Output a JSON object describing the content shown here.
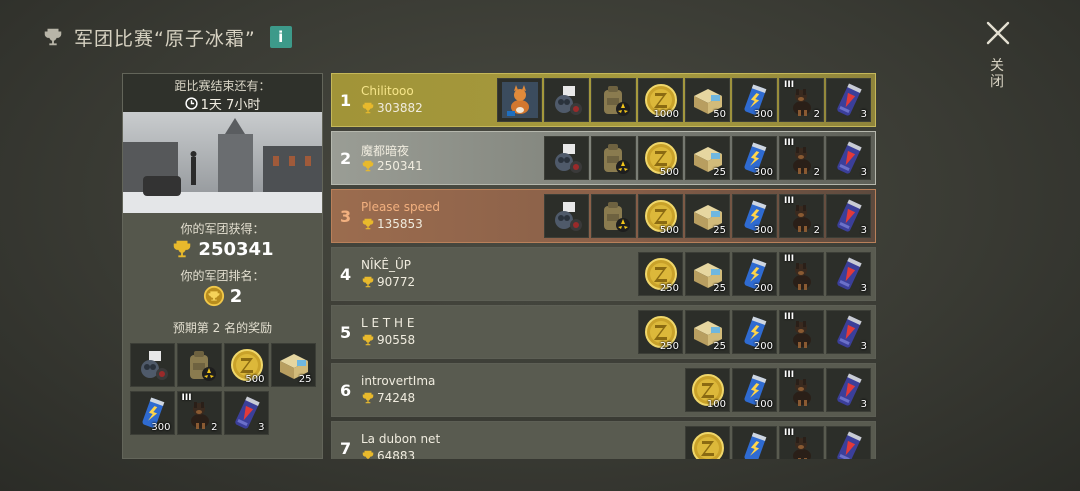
{
  "header": {
    "title": "军团比赛“原子冰霜”",
    "info_label": "i",
    "close_label": "关闭"
  },
  "left_panel": {
    "ends_label": "距比赛结束还有：",
    "time_left": "1天 7小时",
    "your_gain_label": "你的军团获得：",
    "your_points": "250341",
    "your_rank_label": "你的军团排名：",
    "your_rank": "2",
    "expected_label": "预期第 2 名的奖励",
    "rewards": [
      {
        "icon": "gasmask-icon",
        "qty": ""
      },
      {
        "icon": "backpack-icon",
        "qty": ""
      },
      {
        "icon": "coin-icon",
        "qty": "500"
      },
      {
        "icon": "supply-crate-icon",
        "qty": "25"
      },
      {
        "icon": "energy-can-icon",
        "qty": "300"
      },
      {
        "icon": "dog-icon",
        "qty": "2",
        "tier": "III"
      },
      {
        "icon": "soda-can-icon",
        "qty": "3"
      }
    ]
  },
  "ranking": [
    {
      "rank": "1",
      "name": "Chilitooo",
      "points": "303882",
      "items": [
        {
          "icon": "cat-pet-icon",
          "qty": ""
        },
        {
          "icon": "gasmask-icon",
          "qty": ""
        },
        {
          "icon": "backpack-icon",
          "qty": ""
        },
        {
          "icon": "coin-icon",
          "qty": "1000"
        },
        {
          "icon": "supply-crate-icon",
          "qty": "50"
        },
        {
          "icon": "energy-can-icon",
          "qty": "300"
        },
        {
          "icon": "dog-icon",
          "qty": "2",
          "tier": "III"
        },
        {
          "icon": "soda-can-icon",
          "qty": "3"
        }
      ]
    },
    {
      "rank": "2",
      "name": "魔都暗夜",
      "points": "250341",
      "items": [
        {
          "icon": "gasmask-icon",
          "qty": ""
        },
        {
          "icon": "backpack-icon",
          "qty": ""
        },
        {
          "icon": "coin-icon",
          "qty": "500"
        },
        {
          "icon": "supply-crate-icon",
          "qty": "25"
        },
        {
          "icon": "energy-can-icon",
          "qty": "300"
        },
        {
          "icon": "dog-icon",
          "qty": "2",
          "tier": "III"
        },
        {
          "icon": "soda-can-icon",
          "qty": "3"
        }
      ]
    },
    {
      "rank": "3",
      "name": "Please speed",
      "points": "135853",
      "items": [
        {
          "icon": "gasmask-icon",
          "qty": ""
        },
        {
          "icon": "backpack-icon",
          "qty": ""
        },
        {
          "icon": "coin-icon",
          "qty": "500"
        },
        {
          "icon": "supply-crate-icon",
          "qty": "25"
        },
        {
          "icon": "energy-can-icon",
          "qty": "300"
        },
        {
          "icon": "dog-icon",
          "qty": "2",
          "tier": "III"
        },
        {
          "icon": "soda-can-icon",
          "qty": "3"
        }
      ]
    },
    {
      "rank": "4",
      "name": "NÎKÊ_ÛP",
      "points": "90772",
      "items": [
        {
          "icon": "coin-icon",
          "qty": "250"
        },
        {
          "icon": "supply-crate-icon",
          "qty": "25"
        },
        {
          "icon": "energy-can-icon",
          "qty": "200"
        },
        {
          "icon": "dog-icon",
          "qty": "",
          "tier": "III"
        },
        {
          "icon": "soda-can-icon",
          "qty": "3"
        }
      ]
    },
    {
      "rank": "5",
      "name": "L E T H E",
      "points": "90558",
      "items": [
        {
          "icon": "coin-icon",
          "qty": "250"
        },
        {
          "icon": "supply-crate-icon",
          "qty": "25"
        },
        {
          "icon": "energy-can-icon",
          "qty": "200"
        },
        {
          "icon": "dog-icon",
          "qty": "",
          "tier": "III"
        },
        {
          "icon": "soda-can-icon",
          "qty": "3"
        }
      ]
    },
    {
      "rank": "6",
      "name": "introvertIma",
      "points": "74248",
      "items": [
        {
          "icon": "coin-icon",
          "qty": "100"
        },
        {
          "icon": "energy-can-icon",
          "qty": "100"
        },
        {
          "icon": "dog-icon",
          "qty": "",
          "tier": "III"
        },
        {
          "icon": "soda-can-icon",
          "qty": "3"
        }
      ]
    },
    {
      "rank": "7",
      "name": "La dubon net",
      "points": "64883",
      "items": [
        {
          "icon": "coin-icon",
          "qty": ""
        },
        {
          "icon": "energy-can-icon",
          "qty": ""
        },
        {
          "icon": "dog-icon",
          "qty": "",
          "tier": "III"
        },
        {
          "icon": "soda-can-icon",
          "qty": ""
        }
      ]
    }
  ]
}
